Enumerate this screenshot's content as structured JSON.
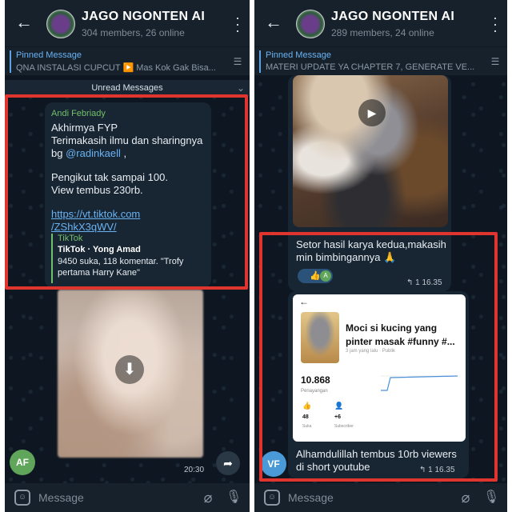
{
  "panels": [
    {
      "group_name": "JAGO NGONTEN AI",
      "status": "304 members, 26 online",
      "pinned_title": "Pinned Message",
      "pinned_text": "QNA INSTALASI CUPCUT ▶️ Mas Kok Gak Bisa...",
      "composer_placeholder": "Message"
    },
    {
      "group_name": "JAGO NGONTEN AI",
      "status": "289 members, 24 online",
      "pinned_title": "Pinned Message",
      "pinned_text": "MATERI UPDATE YA CHAPTER 7, GENERATE VE...",
      "composer_placeholder": "Message"
    }
  ],
  "left_chat": {
    "unread_label": "Unread Messages",
    "sender": "Andi Febriady",
    "line1": "Akhirmya FYP",
    "line2": "Terimakasih ilmu dan sharingnya",
    "line3_prefix": "bg ",
    "mention": "@radinkaell",
    "line3_suffix": " ,",
    "line4": "Pengikut tak sampai 100.",
    "line5": "View tembus 230rb.",
    "link_line1": "https://vt.tiktok.com",
    "link_line2": "/ZShkX3qWV/",
    "preview_site": "TikTok",
    "preview_title": "TikTok · Yong Amad",
    "preview_desc": "9450 suka, 118 komentar. \"Trofy pertama Harry Kane\"",
    "media_time": "20:30",
    "avatar_initials": "AF",
    "avatar_color": "#5fa55a"
  },
  "right_chat": {
    "caption1": "Setor hasil karya kedua,makasih min bimbingannya 🙏",
    "reaction_emoji": "👍",
    "reaction_avatar": "A",
    "meta1": "↰ 1  16.35",
    "shot_back": "←",
    "shot_title": "Moci si kucing yang pinter masak #funny #...",
    "shot_sub": "3 jam yang lalu · Publik",
    "shot_views": "10.868",
    "shot_views_label": "Penayangan",
    "shot_likes": "48",
    "shot_likes_label": "Suka",
    "shot_subs": "+6",
    "shot_subs_label": "Subscriber",
    "caption2": "Alhamdulillah tembus 10rb viewers di short youtube",
    "meta2": "↰ 1  16.35",
    "avatar_initials": "VF",
    "avatar_color": "#4a9ad8"
  },
  "colors": {
    "highlight": "#e0342f",
    "accent": "#6ab3f3",
    "sender": "#73c06a"
  },
  "icons": [
    "back-arrow-icon",
    "menu-dots-icon",
    "pin-list-icon",
    "download-icon",
    "forward-icon",
    "play-icon",
    "emoji-icon",
    "attach-icon",
    "mic-icon"
  ]
}
